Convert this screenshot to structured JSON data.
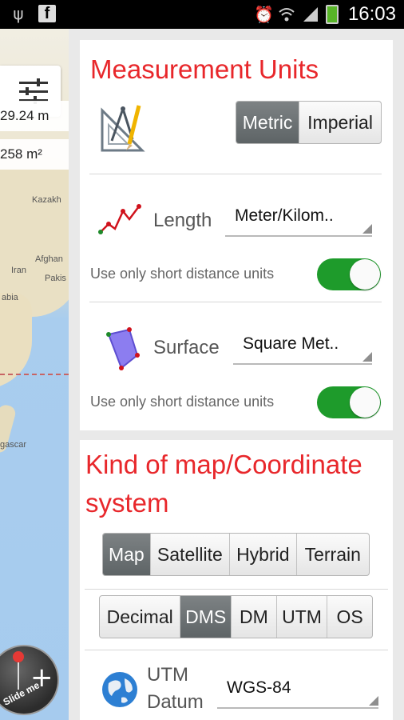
{
  "status_bar": {
    "time": "16:03",
    "left_icons": [
      "usb-icon",
      "facebook-icon"
    ],
    "right_icons": [
      "alarm-icon",
      "wifi-icon",
      "signal-icon",
      "battery-icon"
    ]
  },
  "map": {
    "readout_length": "29.24 m",
    "readout_area": "258 m²",
    "labels": [
      "Kazakh",
      "Afghan",
      "Iran",
      "Pakis",
      "abia",
      "gascar"
    ],
    "slide_button_label": "Slide me"
  },
  "measurement_units": {
    "title": "Measurement Units",
    "system_options": [
      "Metric",
      "Imperial"
    ],
    "system_selected": "Metric",
    "length": {
      "label": "Length",
      "value": "Meter/Kilom..",
      "short_units_label": "Use only short distance units",
      "short_units_enabled": true
    },
    "surface": {
      "label": "Surface",
      "value": "Square Met..",
      "short_units_label": "Use only short distance units",
      "short_units_enabled": true
    }
  },
  "map_coordinate": {
    "title_line1": "Kind of map/Coordinate",
    "title_line2": "system",
    "map_types": [
      "Map",
      "Satellite",
      "Hybrid",
      "Terrain"
    ],
    "map_type_selected": "Map",
    "coord_formats": [
      "Decimal",
      "DMS",
      "DM",
      "UTM",
      "OS"
    ],
    "coord_selected": "DMS",
    "datum": {
      "label_line1": "UTM",
      "label_line2": "Datum",
      "value": "WGS-84"
    }
  },
  "colors": {
    "accent_red": "#e8272b",
    "toggle_green": "#1e9b2b",
    "selected_segment": "#6b7072"
  }
}
